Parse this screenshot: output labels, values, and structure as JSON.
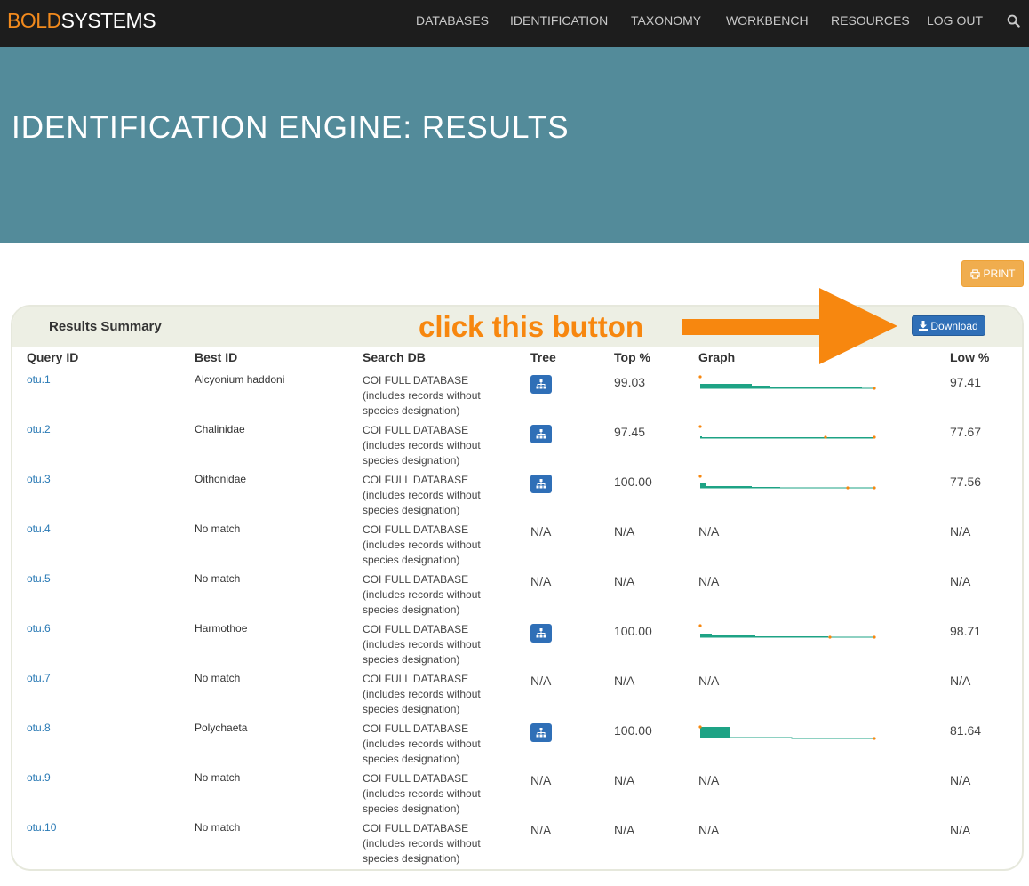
{
  "header": {
    "logo_part1": "BOLD",
    "logo_part2": "SYSTEMS",
    "nav": [
      "DATABASES",
      "IDENTIFICATION",
      "TAXONOMY",
      "WORKBENCH",
      "RESOURCES",
      "LOG OUT"
    ]
  },
  "banner": {
    "title": "IDENTIFICATION ENGINE: RESULTS"
  },
  "toolbar": {
    "print_label": "PRINT"
  },
  "panel": {
    "title": "Results Summary",
    "download_label": "Download",
    "annotation": "click this button"
  },
  "columns": [
    "Query ID",
    "Best ID",
    "Search DB",
    "Tree",
    "Top %",
    "Graph",
    "Low %"
  ],
  "rows": [
    {
      "qid": "otu.1",
      "best": "Alcyonium haddoni",
      "db": "COI FULL DATABASE (includes records without species designation)",
      "tree": true,
      "top": "99.03",
      "graph": "g1",
      "low": "97.41"
    },
    {
      "qid": "otu.2",
      "best": "Chalinidae",
      "db": "COI FULL DATABASE (includes records without species designation)",
      "tree": true,
      "top": "97.45",
      "graph": "g2",
      "low": "77.67"
    },
    {
      "qid": "otu.3",
      "best": "Oithonidae",
      "db": "COI FULL DATABASE (includes records without species designation)",
      "tree": true,
      "top": "100.00",
      "graph": "g3",
      "low": "77.56"
    },
    {
      "qid": "otu.4",
      "best": "No match",
      "db": "COI FULL DATABASE (includes records without species designation)",
      "tree": false,
      "top": "N/A",
      "graph": "N/A",
      "low": "N/A"
    },
    {
      "qid": "otu.5",
      "best": "No match",
      "db": "COI FULL DATABASE (includes records without species designation)",
      "tree": false,
      "top": "N/A",
      "graph": "N/A",
      "low": "N/A"
    },
    {
      "qid": "otu.6",
      "best": "Harmothoe",
      "db": "COI FULL DATABASE (includes records without species designation)",
      "tree": true,
      "top": "100.00",
      "graph": "g6",
      "low": "98.71"
    },
    {
      "qid": "otu.7",
      "best": "No match",
      "db": "COI FULL DATABASE (includes records without species designation)",
      "tree": false,
      "top": "N/A",
      "graph": "N/A",
      "low": "N/A"
    },
    {
      "qid": "otu.8",
      "best": "Polychaeta",
      "db": "COI FULL DATABASE (includes records without species designation)",
      "tree": true,
      "top": "100.00",
      "graph": "g8",
      "low": "81.64"
    },
    {
      "qid": "otu.9",
      "best": "No match",
      "db": "COI FULL DATABASE (includes records without species designation)",
      "tree": false,
      "top": "N/A",
      "graph": "N/A",
      "low": "N/A"
    },
    {
      "qid": "otu.10",
      "best": "No match",
      "db": "COI FULL DATABASE (includes records without species designation)",
      "tree": false,
      "top": "N/A",
      "graph": "N/A",
      "low": "N/A"
    }
  ],
  "colors": {
    "nav_bg": "#1d1d1d",
    "banner": "#538b9a",
    "accent": "#f28a1d",
    "link": "#2a7ab5",
    "button": "#2f6fb7",
    "graph_fill": "#1ea385"
  }
}
